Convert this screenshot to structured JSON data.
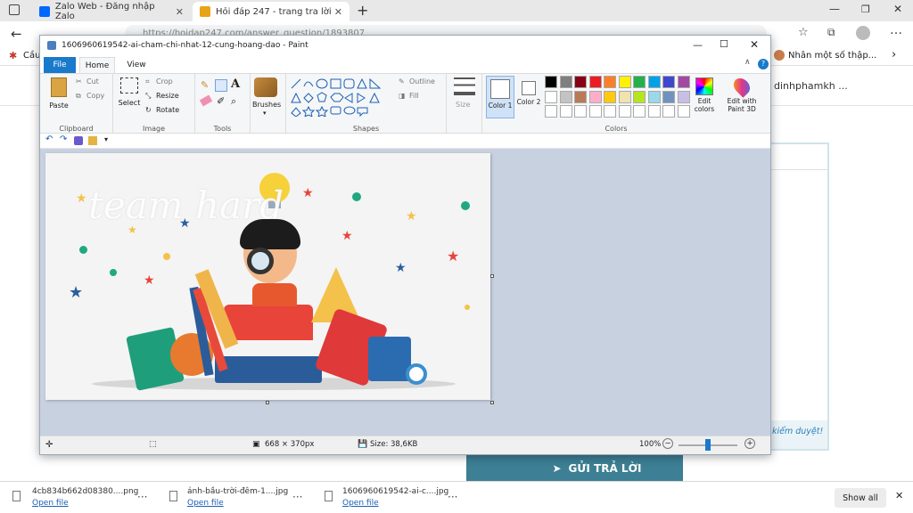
{
  "tabs": [
    {
      "title": "Zalo Web - Đăng nhập Zalo"
    },
    {
      "title": "Hỏi đáp 247 - trang tra lời"
    }
  ],
  "address": {
    "url": "https://hoidap247.com/answer_question/1893807"
  },
  "bookmarks": {
    "left": "Cầu",
    "right": "Nhân một số thập..."
  },
  "page_bg": {
    "username": "dinhphamkh ...",
    "pending": "kiểm duyệt!",
    "submit": "GỬI TRẢ LỜI"
  },
  "downloads": {
    "items": [
      {
        "name": "4cb834b662d08380....png",
        "open": "Open file"
      },
      {
        "name": "ảnh-bầu-trời-đêm-1....jpg",
        "open": "Open file"
      },
      {
        "name": "1606960619542-ai-c....jpg",
        "open": "Open file"
      }
    ],
    "show_all": "Show all"
  },
  "paint": {
    "title": "1606960619542-ai-cham-chi-nhat-12-cung-hoang-dao - Paint",
    "ribbon_tabs": {
      "file": "File",
      "home": "Home",
      "view": "View"
    },
    "clipboard": {
      "paste": "Paste",
      "cut": "Cut",
      "copy": "Copy",
      "label": "Clipboard"
    },
    "image": {
      "select": "Select",
      "crop": "Crop",
      "resize": "Resize",
      "rotate": "Rotate",
      "label": "Image"
    },
    "tools": {
      "label": "Tools",
      "text_tool": "A"
    },
    "brushes": {
      "label": "Brushes"
    },
    "shapes": {
      "outline": "Outline",
      "fill": "Fill",
      "label": "Shapes"
    },
    "size": {
      "label": "Size"
    },
    "colors": {
      "color1": "Color 1",
      "color2": "Color 2",
      "edit": "Edit colors",
      "paint3d": "Edit with Paint 3D",
      "label": "Colors",
      "palette": [
        "#000000",
        "#7f7f7f",
        "#880015",
        "#ed1c24",
        "#ff7f27",
        "#fff200",
        "#22b14c",
        "#00a2e8",
        "#3f48cc",
        "#a349a4",
        "#ffffff",
        "#c3c3c3",
        "#b97a57",
        "#ffaec9",
        "#ffc90e",
        "#efe4b0",
        "#b5e61d",
        "#99d9ea",
        "#7092be",
        "#c8bfe7"
      ]
    },
    "canvas": {
      "watermark": "team hard"
    },
    "status": {
      "dimensions": "668 × 370px",
      "size": "Size: 38,6KB",
      "zoom": "100%"
    }
  }
}
